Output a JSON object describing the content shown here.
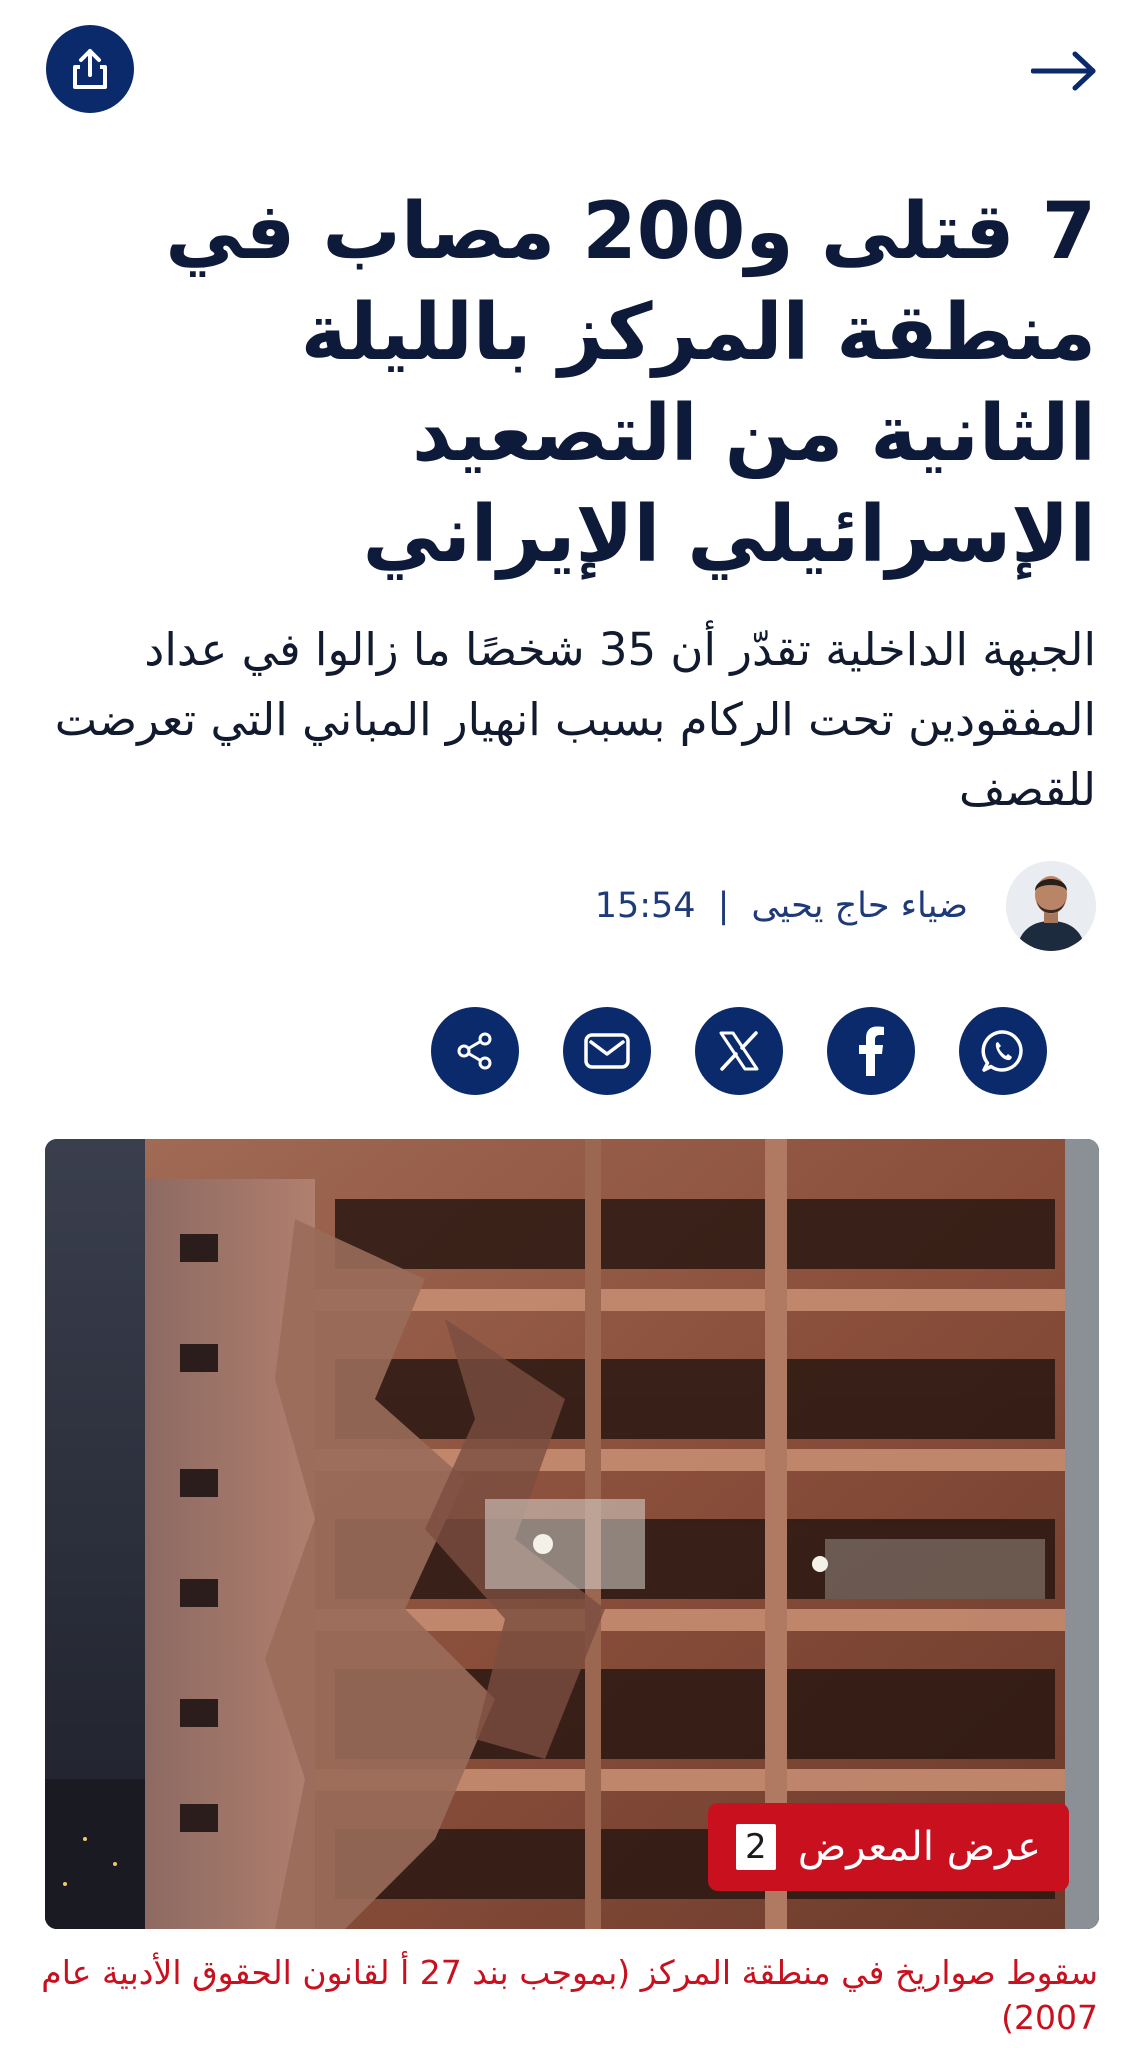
{
  "header": {
    "share_icon": "share-upload-icon",
    "back_icon": "arrow-right-icon"
  },
  "article": {
    "headline": "7 قتلى و200 مصاب في منطقة المركز بالليلة الثانية من التصعيد الإسرائيلي الإيراني",
    "subtitle": "الجبهة الداخلية تقدّر أن 35 شخصًا ما زالوا في عداد المفقودين تحت الركام بسبب انهيار المباني التي تعرضت للقصف",
    "author": "ضياء حاج يحيى",
    "separator": "|",
    "time": "15:54"
  },
  "social": {
    "icons": [
      "whatsapp-icon",
      "facebook-icon",
      "x-icon",
      "mail-icon",
      "share-icon"
    ]
  },
  "gallery": {
    "count": "2",
    "label": "عرض المعرض"
  },
  "photo": {
    "caption": "سقوط صواريخ في منطقة المركز (بموجب بند 27 أ لقانون الحقوق الأدبية عام 2007)"
  },
  "colors": {
    "brand_navy": "#0b2a6b",
    "headline_text": "#0d1a3a",
    "accent_red": "#c8101f"
  }
}
